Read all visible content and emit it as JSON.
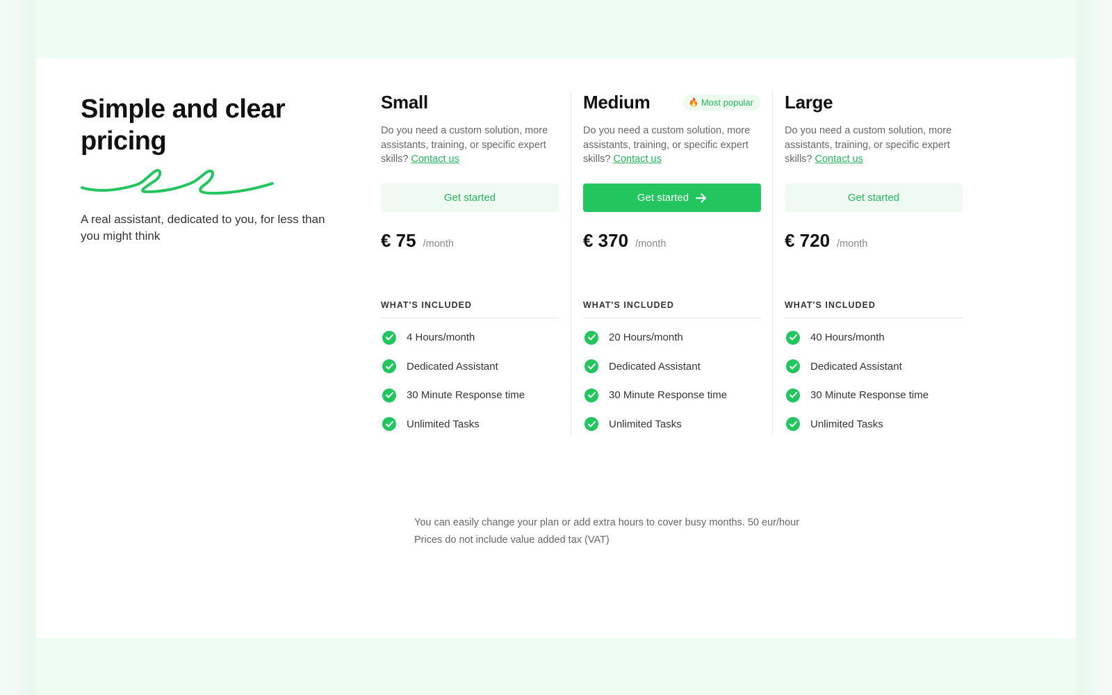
{
  "intro": {
    "title": "Simple and clear pricing",
    "subtitle": "A real assistant, dedicated to you, for less than you might think"
  },
  "colors": {
    "accent": "#22c55e",
    "accent_text": "#22b45a",
    "accent_soft": "#effbf2",
    "page_bg": "#f2fbf4"
  },
  "plans": [
    {
      "name": "Small",
      "badge": "",
      "description": "Do you need a custom solution, more assistants, training, or specific expert skills?",
      "contact_link": "Contact us",
      "button_label": "Get started",
      "button_style": "light",
      "price": "€ 75",
      "period": "/month",
      "included_label": "WHAT'S INCLUDED",
      "features": [
        "4 Hours/month",
        "Dedicated Assistant",
        "30 Minute Response time",
        "Unlimited Tasks"
      ]
    },
    {
      "name": "Medium",
      "badge": "Most popular",
      "badge_icon": "flame-icon",
      "description": "Do you need a custom solution, more assistants, training, or specific expert skills?",
      "contact_link": "Contact us",
      "button_label": "Get started",
      "button_style": "solid",
      "button_icon": "arrow-right-icon",
      "price": "€ 370",
      "period": "/month",
      "included_label": "WHAT'S INCLUDED",
      "features": [
        "20 Hours/month",
        "Dedicated Assistant",
        "30 Minute Response time",
        "Unlimited Tasks"
      ]
    },
    {
      "name": "Large",
      "badge": "",
      "description": "Do you need a custom solution, more assistants, training, or specific expert skills?",
      "contact_link": "Contact us",
      "button_label": "Get started",
      "button_style": "light",
      "price": "€ 720",
      "period": "/month",
      "included_label": "WHAT'S INCLUDED",
      "features": [
        "40 Hours/month",
        "Dedicated Assistant",
        "30 Minute Response time",
        "Unlimited Tasks"
      ]
    }
  ],
  "footnote": {
    "line1": "You can easily change your plan or add extra hours to cover busy months. 50 eur/hour",
    "line2": "Prices do not include value added tax (VAT)"
  }
}
